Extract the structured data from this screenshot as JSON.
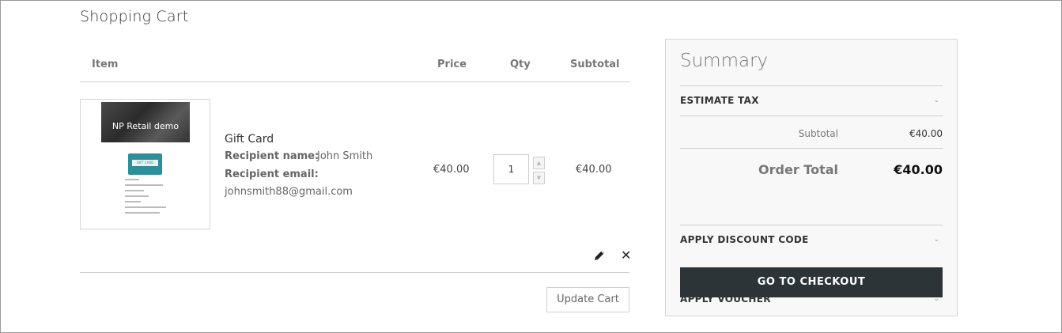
{
  "page": {
    "title": "Shopping Cart"
  },
  "cart": {
    "headers": {
      "item": "Item",
      "price": "Price",
      "qty": "Qty",
      "subtotal": "Subtotal"
    },
    "items": [
      {
        "thumbnail": {
          "banner_text": "NP Retail demo",
          "card_label": "GIFT CARD"
        },
        "name": "Gift Card",
        "options": [
          {
            "label": "Recipient name:",
            "value": "John Smith"
          },
          {
            "label": "Recipient email:",
            "value": "johnsmith88@gmail.com"
          }
        ],
        "price": "€40.00",
        "qty": "1",
        "subtotal": "€40.00",
        "actions": {
          "edit_icon": "pencil-icon",
          "remove_icon": "close-icon"
        }
      }
    ],
    "update_label": "Update Cart"
  },
  "summary": {
    "title": "Summary",
    "estimate_tax": "ESTIMATE TAX",
    "subtotal_label": "Subtotal",
    "subtotal_value": "€40.00",
    "total_label": "Order Total",
    "total_value": "€40.00",
    "discount_label": "APPLY DISCOUNT CODE",
    "voucher_label": "APPLY VOUCHER",
    "checkout_label": "GO TO CHECKOUT",
    "chevron_icon": "chevron-down-icon"
  },
  "colors": {
    "checkout_bg": "#2c3438",
    "summary_bg": "#f8f8f8"
  }
}
